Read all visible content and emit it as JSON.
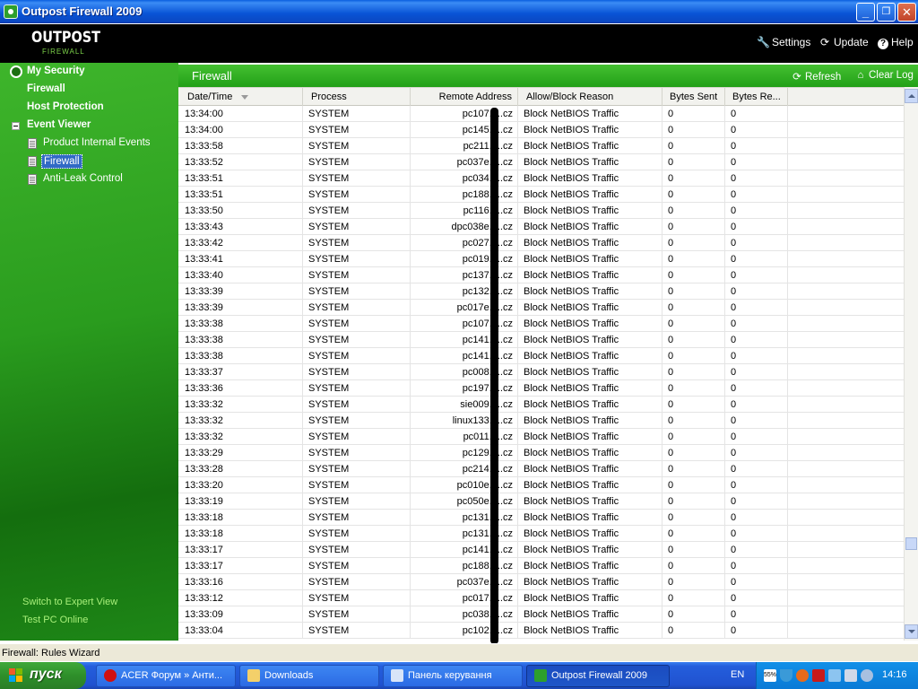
{
  "window": {
    "title": "Outpost Firewall 2009",
    "min_glyph": "_",
    "max_glyph": "❐",
    "close_glyph": "✕"
  },
  "toolbar": {
    "logo_line1": "OUTPOST",
    "logo_line2": "FIREWALL",
    "settings_label": "Settings",
    "settings_icon": "wrench-icon",
    "update_label": "Update",
    "update_icon": "refresh-icon",
    "help_label": "Help",
    "help_icon": "question-icon"
  },
  "sidebar": {
    "my_security": "My Security",
    "firewall": "Firewall",
    "host_protection": "Host Protection",
    "event_viewer": "Event Viewer",
    "product_internal_events": "Product Internal Events",
    "firewall_log": "Firewall",
    "anti_leak": "Anti-Leak Control",
    "switch_expert": "Switch to Expert View",
    "test_pc": "Test PC Online"
  },
  "content": {
    "title": "Firewall",
    "refresh_label": "Refresh",
    "clear_log_label": "Clear Log"
  },
  "columns": {
    "datetime": "Date/Time",
    "process": "Process",
    "remote_address": "Remote Address",
    "reason": "Allow/Block Reason",
    "bytes_sent": "Bytes Sent",
    "bytes_received": "Bytes Re..."
  },
  "rows": [
    [
      "13:34:00",
      "SYSTEM",
      "pc107.f...cz",
      "Block NetBIOS Traffic",
      "0",
      "0"
    ],
    [
      "13:34:00",
      "SYSTEM",
      "pc145.f...cz",
      "Block NetBIOS Traffic",
      "0",
      "0"
    ],
    [
      "13:33:58",
      "SYSTEM",
      "pc211.f...cz",
      "Block NetBIOS Traffic",
      "0",
      "0"
    ],
    [
      "13:33:52",
      "SYSTEM",
      "pc037e.f...cz",
      "Block NetBIOS Traffic",
      "0",
      "0"
    ],
    [
      "13:33:51",
      "SYSTEM",
      "pc034.f...cz",
      "Block NetBIOS Traffic",
      "0",
      "0"
    ],
    [
      "13:33:51",
      "SYSTEM",
      "pc188.f...cz",
      "Block NetBIOS Traffic",
      "0",
      "0"
    ],
    [
      "13:33:50",
      "SYSTEM",
      "pc116.f...cz",
      "Block NetBIOS Traffic",
      "0",
      "0"
    ],
    [
      "13:33:43",
      "SYSTEM",
      "dpc038e.f...cz",
      "Block NetBIOS Traffic",
      "0",
      "0"
    ],
    [
      "13:33:42",
      "SYSTEM",
      "pc027.f...cz",
      "Block NetBIOS Traffic",
      "0",
      "0"
    ],
    [
      "13:33:41",
      "SYSTEM",
      "pc019.f...cz",
      "Block NetBIOS Traffic",
      "0",
      "0"
    ],
    [
      "13:33:40",
      "SYSTEM",
      "pc137.f...cz",
      "Block NetBIOS Traffic",
      "0",
      "0"
    ],
    [
      "13:33:39",
      "SYSTEM",
      "pc132.f...cz",
      "Block NetBIOS Traffic",
      "0",
      "0"
    ],
    [
      "13:33:39",
      "SYSTEM",
      "pc017e.f...cz",
      "Block NetBIOS Traffic",
      "0",
      "0"
    ],
    [
      "13:33:38",
      "SYSTEM",
      "pc107.f...cz",
      "Block NetBIOS Traffic",
      "0",
      "0"
    ],
    [
      "13:33:38",
      "SYSTEM",
      "pc141.f...cz",
      "Block NetBIOS Traffic",
      "0",
      "0"
    ],
    [
      "13:33:38",
      "SYSTEM",
      "pc141.f...cz",
      "Block NetBIOS Traffic",
      "0",
      "0"
    ],
    [
      "13:33:37",
      "SYSTEM",
      "pc008.f...cz",
      "Block NetBIOS Traffic",
      "0",
      "0"
    ],
    [
      "13:33:36",
      "SYSTEM",
      "pc197.f...cz",
      "Block NetBIOS Traffic",
      "0",
      "0"
    ],
    [
      "13:33:32",
      "SYSTEM",
      "sie009.f...cz",
      "Block NetBIOS Traffic",
      "0",
      "0"
    ],
    [
      "13:33:32",
      "SYSTEM",
      "linux133.f...cz",
      "Block NetBIOS Traffic",
      "0",
      "0"
    ],
    [
      "13:33:32",
      "SYSTEM",
      "pc011.f...cz",
      "Block NetBIOS Traffic",
      "0",
      "0"
    ],
    [
      "13:33:29",
      "SYSTEM",
      "pc129.f...cz",
      "Block NetBIOS Traffic",
      "0",
      "0"
    ],
    [
      "13:33:28",
      "SYSTEM",
      "pc214.f...cz",
      "Block NetBIOS Traffic",
      "0",
      "0"
    ],
    [
      "13:33:20",
      "SYSTEM",
      "pc010e.f...cz",
      "Block NetBIOS Traffic",
      "0",
      "0"
    ],
    [
      "13:33:19",
      "SYSTEM",
      "pc050e.f...cz",
      "Block NetBIOS Traffic",
      "0",
      "0"
    ],
    [
      "13:33:18",
      "SYSTEM",
      "pc131.f...cz",
      "Block NetBIOS Traffic",
      "0",
      "0"
    ],
    [
      "13:33:18",
      "SYSTEM",
      "pc131.f...cz",
      "Block NetBIOS Traffic",
      "0",
      "0"
    ],
    [
      "13:33:17",
      "SYSTEM",
      "pc141.f...cz",
      "Block NetBIOS Traffic",
      "0",
      "0"
    ],
    [
      "13:33:17",
      "SYSTEM",
      "pc188.f...cz",
      "Block NetBIOS Traffic",
      "0",
      "0"
    ],
    [
      "13:33:16",
      "SYSTEM",
      "pc037e.f...cz",
      "Block NetBIOS Traffic",
      "0",
      "0"
    ],
    [
      "13:33:12",
      "SYSTEM",
      "pc017.f...cz",
      "Block NetBIOS Traffic",
      "0",
      "0"
    ],
    [
      "13:33:09",
      "SYSTEM",
      "pc038.f...cz",
      "Block NetBIOS Traffic",
      "0",
      "0"
    ],
    [
      "13:33:04",
      "SYSTEM",
      "pc102.f...cz",
      "Block NetBIOS Traffic",
      "0",
      "0"
    ]
  ],
  "statusbar": {
    "text": "Firewall: Rules Wizard"
  },
  "taskbar": {
    "start_label": "пуск",
    "tasks": [
      {
        "label": "ACER Форум » Анти...",
        "icon": "opera-icon"
      },
      {
        "label": "Downloads",
        "icon": "folder-icon"
      },
      {
        "label": "Панель керування",
        "icon": "control-panel-icon"
      },
      {
        "label": "Outpost Firewall 2009",
        "icon": "outpost-icon"
      }
    ],
    "language": "EN",
    "tray_battery_text": "55%",
    "clock": "14:16"
  },
  "colors": {
    "sidebar_green": "#2a9c1e",
    "header_green": "#33b024",
    "titlebar_blue": "#0954d6",
    "taskbar_blue": "#245edc",
    "selection_blue": "#316ac5"
  }
}
